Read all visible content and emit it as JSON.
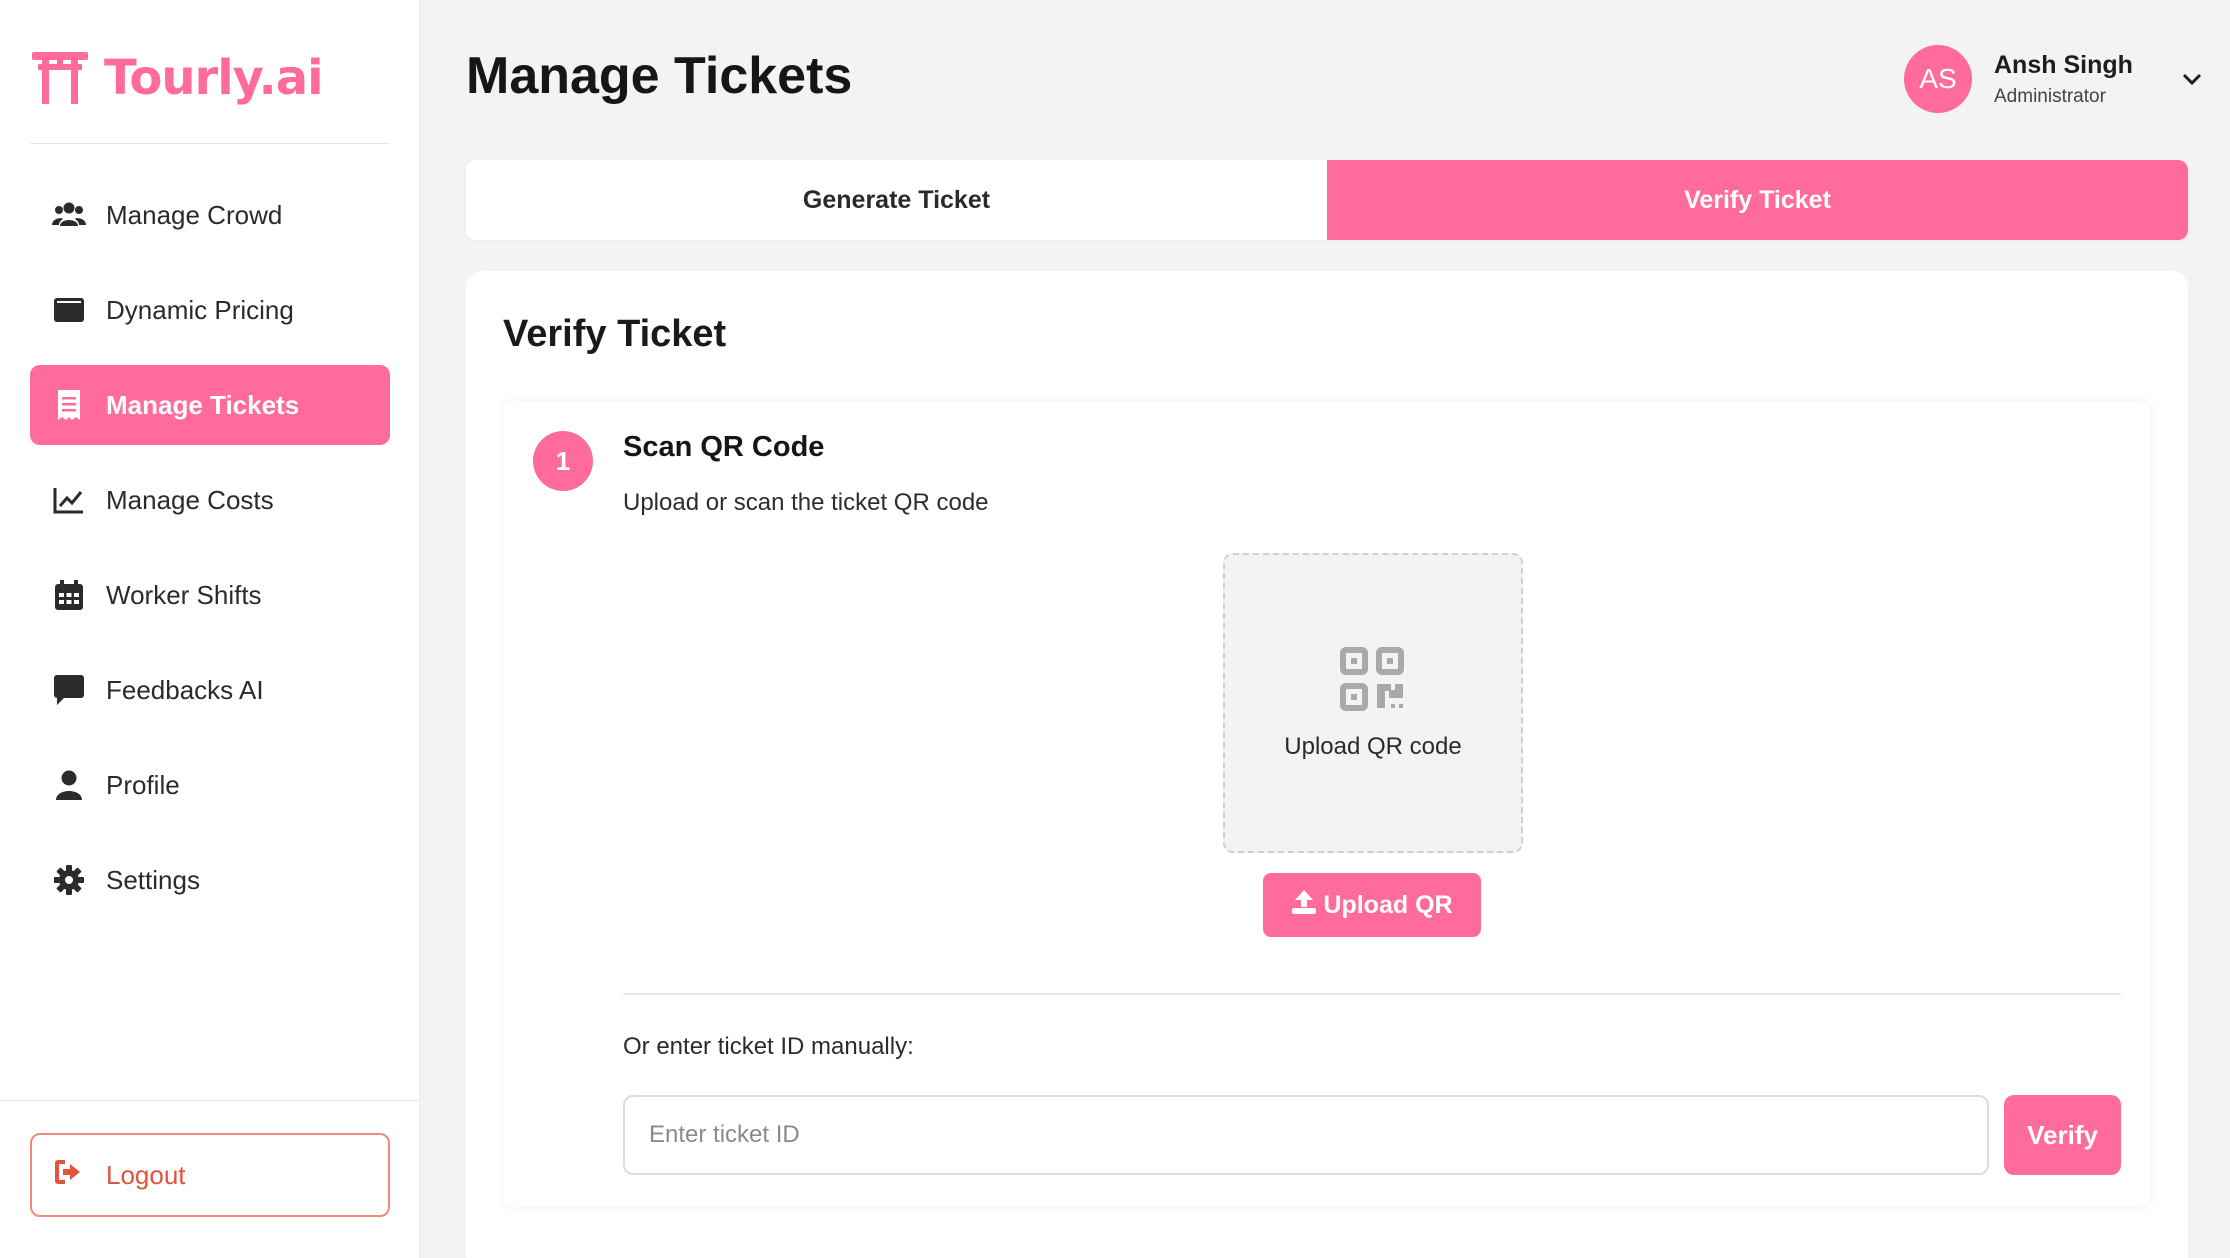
{
  "brand": {
    "name": "Tourly.ai",
    "color": "#ff6b9b"
  },
  "sidebar": {
    "items": [
      {
        "label": "Manage Crowd",
        "icon": "users-icon"
      },
      {
        "label": "Dynamic Pricing",
        "icon": "wallet-icon"
      },
      {
        "label": "Manage Tickets",
        "icon": "receipt-icon",
        "active": true
      },
      {
        "label": "Manage Costs",
        "icon": "line-chart-icon"
      },
      {
        "label": "Worker Shifts",
        "icon": "calendar-icon"
      },
      {
        "label": "Feedbacks AI",
        "icon": "comment-icon"
      },
      {
        "label": "Profile",
        "icon": "user-icon"
      },
      {
        "label": "Settings",
        "icon": "gear-icon"
      }
    ],
    "logout_label": "Logout"
  },
  "header": {
    "title": "Manage Tickets",
    "user": {
      "initials": "AS",
      "name": "Ansh Singh",
      "role": "Administrator"
    }
  },
  "tabs": [
    {
      "label": "Generate Ticket",
      "active": false
    },
    {
      "label": "Verify Ticket",
      "active": true
    }
  ],
  "verify": {
    "title": "Verify Ticket",
    "step": {
      "number": "1",
      "title": "Scan QR Code",
      "description": "Upload or scan the ticket QR code",
      "drop_label": "Upload QR code",
      "upload_button": "Upload QR",
      "manual_label": "Or enter ticket ID manually:",
      "input_placeholder": "Enter ticket ID",
      "input_value": "",
      "verify_button": "Verify"
    }
  },
  "colors": {
    "accent": "#ff6b9b",
    "logout": "#e2533e",
    "background": "#f3f3f3"
  }
}
